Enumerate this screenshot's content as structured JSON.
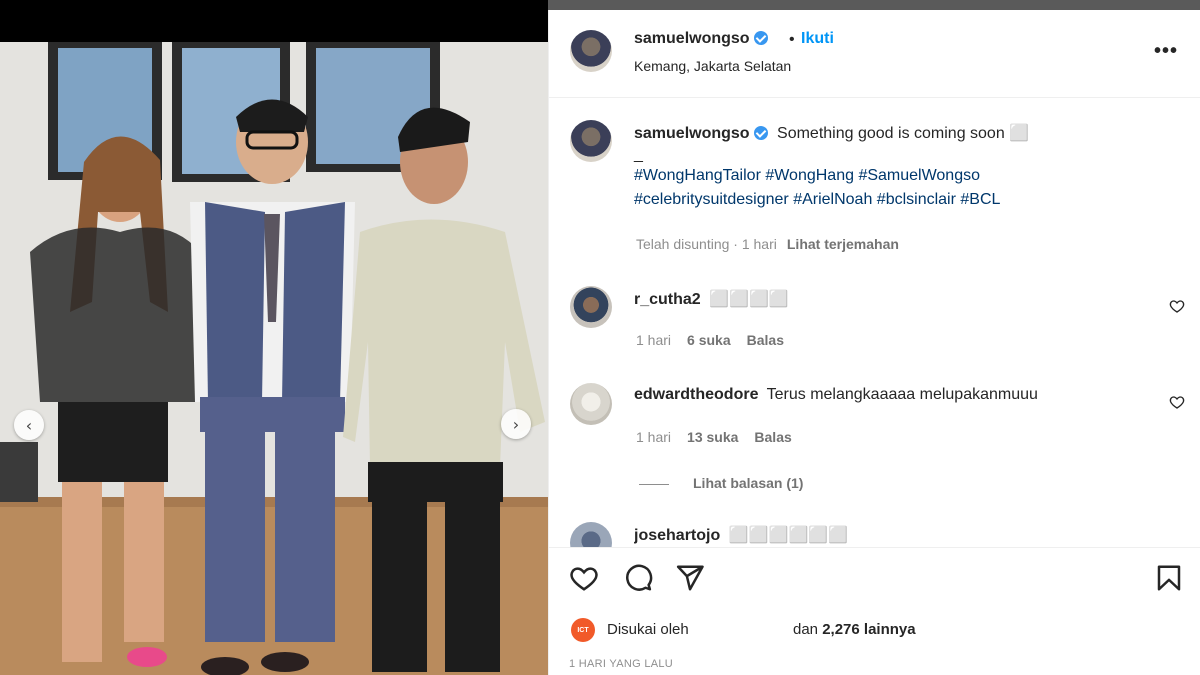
{
  "post": {
    "username": "samuelwongso",
    "follow_label": "Ikuti",
    "location": "Kemang, Jakarta Selatan",
    "more_label": "•••"
  },
  "caption": {
    "username": "samuelwongso",
    "text": "Something good is coming soon ⬜",
    "dash": "_",
    "hashtags_line1": "#WongHangTailor #WongHang #SamuelWongso",
    "hashtags_line2": "#celebritysuitdesigner #ArielNoah #bclsinclair #BCL",
    "edited": "Telah disunting · 1 hari",
    "translate": "Lihat terjemahan"
  },
  "comments": [
    {
      "username": "r_cutha2",
      "text": "⬜⬜⬜⬜",
      "time": "1 hari",
      "likes": "6 suka",
      "reply": "Balas"
    },
    {
      "username": "edwardtheodore",
      "text": "Terus melangkaaaaa melupakanmuuu",
      "time": "1 hari",
      "likes": "13 suka",
      "reply": "Balas"
    },
    {
      "username": "josehartojo",
      "text": "⬜⬜⬜⬜⬜⬜"
    }
  ],
  "view_replies": "Lihat balasan (1)",
  "likes": {
    "prefix": "Disukai oleh",
    "suffix_pre": "dan",
    "count": "2,276 lainnya",
    "avatar_text": "ICT"
  },
  "time_ago": "1 HARI YANG LALU",
  "icons": [
    "heart-icon",
    "comment-icon",
    "share-icon",
    "bookmark-icon",
    "verified-icon",
    "chevron-left-icon",
    "chevron-right-icon"
  ],
  "colors": {
    "link_blue": "#0095f6",
    "hashtag": "#00376b",
    "muted": "#8e8e8e"
  }
}
